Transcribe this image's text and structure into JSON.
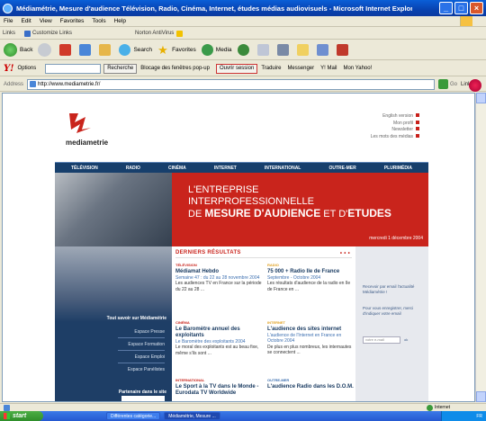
{
  "window": {
    "title": "Médiamétrie, Mesure d'audience Télévision, Radio, Cinéma, Internet, études médias audiovisuels - Microsoft Internet Explorer",
    "controls": [
      "_",
      "□",
      "×"
    ]
  },
  "menu": [
    "File",
    "Edit",
    "View",
    "Favorites",
    "Tools",
    "Help"
  ],
  "links_bar": {
    "items": [
      "Links",
      "Customize Links",
      "Norton AntiVirus"
    ]
  },
  "nav_toolbar": {
    "back": "Back",
    "search": "Search",
    "favorites": "Favorites",
    "media": "Media"
  },
  "yahoo_bar": {
    "logo": "Y!",
    "options": "Options",
    "search_btn": "Recherche",
    "popup": "Blocage des fenêtres pop-up",
    "session": "Ouvrir session",
    "translate": "Traduire",
    "messenger": "Messenger",
    "mail": "Y! Mail",
    "myyahoo": "Mon Yahoo!"
  },
  "address_bar": {
    "label": "Address",
    "url": "http://www.mediametrie.fr/",
    "go": "Go",
    "links": "Links"
  },
  "site": {
    "brand": "mediametrie",
    "top_links": [
      "English version",
      "Mon profil",
      "Newsletter",
      "Les mots des médias"
    ],
    "channels": [
      "TÉLÉVISION",
      "RADIO",
      "CINÉMA",
      "INTERNET",
      "INTERNATIONAL",
      "OUTRE-MER",
      "PLURIMÉDIA"
    ],
    "hero": {
      "line1": "L'ENTREPRISE",
      "line2": "INTERPROFESSIONNELLE",
      "line3_pre": "DE ",
      "line3_bold1": "MESURE D'AUDIENCE",
      "line3_mid": " ET D'",
      "line3_bold2": "ETUDES",
      "date": "mercredi 1 décembre 2004"
    },
    "left": {
      "heading": "Tout savoir sur Médiamétrie",
      "spaces": [
        "Espace Presse",
        "Espace Formation",
        "Espace Emploi",
        "Espace Panélistes"
      ],
      "partners": "Partenaire dans le site"
    },
    "results": {
      "heading": "DERNIERS RÉSULTATS",
      "more": "• • •",
      "cards": [
        {
          "tag": "TÉLÉVISION",
          "title": "Médiamat Hebdo",
          "sub": "Semaine 47 : du 22 au 28 novembre 2004",
          "body": "Les audiences TV en France sur la période du 22 au 28 ..."
        },
        {
          "tag": "RADIO",
          "title": "75 000 + Radio Ile de France",
          "sub": "Septembre - Octobre 2004",
          "body": "Les résultats d'audience de la radio en Ile de France en ..."
        },
        {
          "tag": "CINÉMA",
          "title": "Le Baromètre annuel des exploitants",
          "sub": "Le Baromètre des exploitants 2004",
          "body": "Le moral des exploitants est au beau fixe, même s'ils sont ..."
        },
        {
          "tag": "INTERNET",
          "title": "L'audience des sites internet",
          "sub": "L'audience de l'Internet en France en Octobre 2004",
          "body": "De plus en plus nombreux, les internautes se connectent ..."
        },
        {
          "tag": "INTERNATIONAL",
          "title": "Le Sport à la TV dans le Monde - Eurodata TV Worldwide",
          "sub": "",
          "body": ""
        },
        {
          "tag": "OUTRE-MER",
          "title": "L'audience Radio dans les D.O.M.",
          "sub": "",
          "body": ""
        }
      ]
    },
    "right": {
      "p1": "Recevoir par email l'actualité Médiamétrie !",
      "p2": "Pour vous enregistrer, merci d'indiquer votre email",
      "email_placeholder": "votre e-mail",
      "ok": "ok"
    }
  },
  "status": {
    "zone": "Internet"
  },
  "taskbar": {
    "start": "start",
    "tasks": [
      "Différentes catégorie...",
      "Médiamétrie, Mesure ..."
    ],
    "clock": "FR"
  },
  "colors": {
    "brand_red": "#c9241c",
    "nav_blue": "#173f6c",
    "xp_blue": "#0842b0"
  }
}
